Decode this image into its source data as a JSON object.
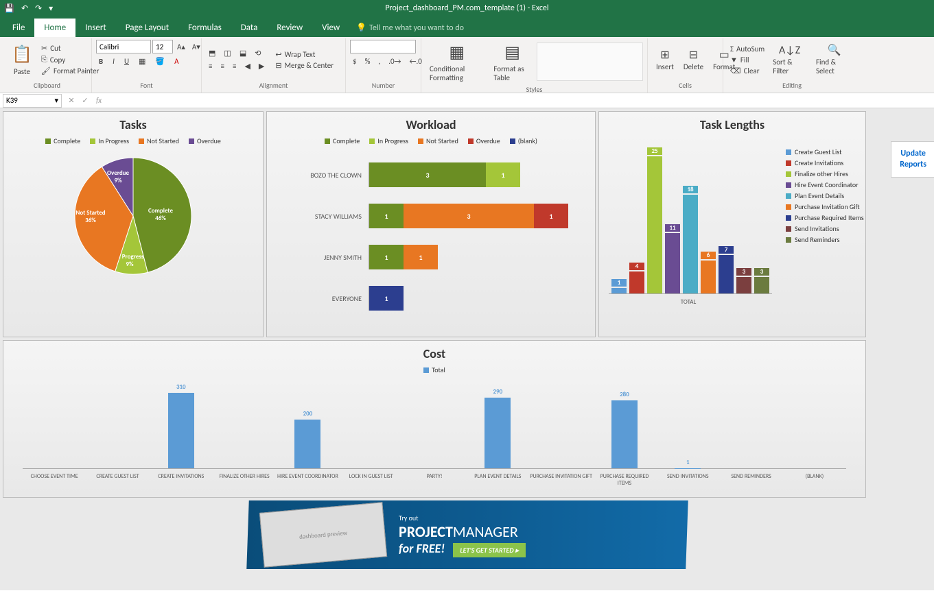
{
  "app": {
    "title": "Project_dashboard_PM.com_template (1) - Excel"
  },
  "tabs": {
    "file": "File",
    "home": "Home",
    "insert": "Insert",
    "page_layout": "Page Layout",
    "formulas": "Formulas",
    "data": "Data",
    "review": "Review",
    "view": "View",
    "tellme": "Tell me what you want to do"
  },
  "ribbon": {
    "clipboard": {
      "label": "Clipboard",
      "paste": "Paste",
      "cut": "Cut",
      "copy": "Copy",
      "fp": "Format Painter"
    },
    "font": {
      "label": "Font",
      "name": "Calibri",
      "size": "12"
    },
    "alignment": {
      "label": "Alignment",
      "wrap": "Wrap Text",
      "merge": "Merge & Center"
    },
    "number": {
      "label": "Number"
    },
    "styles": {
      "label": "Styles",
      "cf": "Conditional Formatting",
      "fat": "Format as Table"
    },
    "cells": {
      "label": "Cells",
      "insert": "Insert",
      "delete": "Delete",
      "format": "Format"
    },
    "editing": {
      "label": "Editing",
      "autosum": "AutoSum",
      "fill": "Fill",
      "clear": "Clear",
      "sort": "Sort & Filter",
      "find": "Find & Select"
    }
  },
  "formula": {
    "cell": "K39",
    "fx": "fx"
  },
  "charts": {
    "tasks": {
      "title": "Tasks",
      "legend": [
        "Complete",
        "In Progress",
        "Not Started",
        "Overdue"
      ],
      "colors": [
        "#6b8e23",
        "#a4c639",
        "#e87722",
        "#6a4c93"
      ],
      "data": [
        {
          "label": "Complete",
          "pct": "46%",
          "value": 46
        },
        {
          "label": "In Progress",
          "pct": "9%",
          "value": 9
        },
        {
          "label": "Not Started",
          "pct": "36%",
          "value": 36
        },
        {
          "label": "Overdue",
          "pct": "9%",
          "value": 9
        }
      ]
    },
    "workload": {
      "title": "Workload",
      "legend": [
        "Complete",
        "In Progress",
        "Not Started",
        "Overdue",
        "(blank)"
      ],
      "colors": [
        "#6b8e23",
        "#a4c639",
        "#e87722",
        "#c0392b",
        "#2c3e8f"
      ],
      "rows": [
        {
          "name": "BOZO THE CLOWN",
          "segs": [
            {
              "c": 0,
              "v": 3,
              "w": 170
            },
            {
              "c": 1,
              "v": 1,
              "w": 50
            }
          ]
        },
        {
          "name": "STACY WILLIAMS",
          "segs": [
            {
              "c": 0,
              "v": 1,
              "w": 50
            },
            {
              "c": 2,
              "v": 3,
              "w": 190
            },
            {
              "c": 3,
              "v": 1,
              "w": 50
            }
          ]
        },
        {
          "name": "JENNY SMITH",
          "segs": [
            {
              "c": 0,
              "v": 1,
              "w": 50
            },
            {
              "c": 2,
              "v": 1,
              "w": 50
            }
          ]
        },
        {
          "name": "EVERYONE",
          "segs": [
            {
              "c": 4,
              "v": 1,
              "w": 50
            }
          ]
        }
      ]
    },
    "task_lengths": {
      "title": "Task Lengths",
      "xlabel": "TOTAL",
      "items": [
        {
          "name": "Create Guest List",
          "v": 1,
          "c": "#5b9bd5"
        },
        {
          "name": "Create Invitations",
          "v": 4,
          "c": "#c0392b"
        },
        {
          "name": "Finalize other Hires",
          "v": 25,
          "c": "#a4c639"
        },
        {
          "name": "Hire Event Coordinator",
          "v": 11,
          "c": "#6a4c93"
        },
        {
          "name": "Plan Event Details",
          "v": 18,
          "c": "#4bacc6"
        },
        {
          "name": "Purchase Invitation Gift",
          "v": 6,
          "c": "#e87722"
        },
        {
          "name": "Purchase Required Items",
          "v": 7,
          "c": "#2c3e8f"
        },
        {
          "name": "Send Invitations",
          "v": 3,
          "c": "#7b3f3f"
        },
        {
          "name": "Send Reminders",
          "v": 3,
          "c": "#6b7b3f"
        }
      ]
    },
    "cost": {
      "title": "Cost",
      "legend": "Total",
      "items": [
        {
          "name": "CHOOSE EVENT TIME",
          "v": 0
        },
        {
          "name": "CREATE GUEST LIST",
          "v": 0
        },
        {
          "name": "CREATE INVITATIONS",
          "v": 310
        },
        {
          "name": "FINALIZE OTHER HIRES",
          "v": 0
        },
        {
          "name": "HIRE EVENT COORDINATOR",
          "v": 200
        },
        {
          "name": "LOCK IN GUEST LIST",
          "v": 0
        },
        {
          "name": "PARTY!",
          "v": 0
        },
        {
          "name": "PLAN EVENT DETAILS",
          "v": 290
        },
        {
          "name": "PURCHASE INVITATION GIFT",
          "v": 0
        },
        {
          "name": "PURCHASE REQUIRED ITEMS",
          "v": 280
        },
        {
          "name": "SEND INVITATIONS",
          "v": 1
        },
        {
          "name": "SEND REMINDERS",
          "v": 0
        },
        {
          "name": "(BLANK)",
          "v": 0
        }
      ]
    }
  },
  "update_btn": {
    "l1": "Update",
    "l2": "Reports"
  },
  "banner": {
    "tryout": "Try out",
    "brand1": "PROJECT",
    "brand2": "MANAGER",
    "free": "for FREE!",
    "cta": "LET'S GET STARTED  ▸"
  },
  "chart_data": [
    {
      "type": "pie",
      "title": "Tasks",
      "categories": [
        "Complete",
        "In Progress",
        "Not Started",
        "Overdue"
      ],
      "values": [
        46,
        9,
        36,
        9
      ]
    },
    {
      "type": "bar",
      "title": "Workload",
      "orientation": "horizontal",
      "stacked": true,
      "categories": [
        "BOZO THE CLOWN",
        "STACY WILLIAMS",
        "JENNY SMITH",
        "EVERYONE"
      ],
      "series": [
        {
          "name": "Complete",
          "values": [
            3,
            1,
            1,
            0
          ]
        },
        {
          "name": "In Progress",
          "values": [
            1,
            0,
            0,
            0
          ]
        },
        {
          "name": "Not Started",
          "values": [
            0,
            3,
            1,
            0
          ]
        },
        {
          "name": "Overdue",
          "values": [
            0,
            1,
            0,
            0
          ]
        },
        {
          "name": "(blank)",
          "values": [
            0,
            0,
            0,
            1
          ]
        }
      ]
    },
    {
      "type": "bar",
      "title": "Task Lengths",
      "categories": [
        "Create Guest List",
        "Create Invitations",
        "Finalize other Hires",
        "Hire Event Coordinator",
        "Plan Event Details",
        "Purchase Invitation Gift",
        "Purchase Required Items",
        "Send Invitations",
        "Send Reminders"
      ],
      "values": [
        1,
        4,
        25,
        11,
        18,
        6,
        7,
        3,
        3
      ],
      "xlabel": "TOTAL"
    },
    {
      "type": "bar",
      "title": "Cost",
      "categories": [
        "CHOOSE EVENT TIME",
        "CREATE GUEST LIST",
        "CREATE INVITATIONS",
        "FINALIZE OTHER HIRES",
        "HIRE EVENT COORDINATOR",
        "LOCK IN GUEST LIST",
        "PARTY!",
        "PLAN EVENT DETAILS",
        "PURCHASE INVITATION GIFT",
        "PURCHASE REQUIRED ITEMS",
        "SEND INVITATIONS",
        "SEND REMINDERS",
        "(BLANK)"
      ],
      "series": [
        {
          "name": "Total",
          "values": [
            0,
            0,
            310,
            0,
            200,
            0,
            0,
            290,
            0,
            280,
            1,
            0,
            0
          ]
        }
      ]
    }
  ]
}
